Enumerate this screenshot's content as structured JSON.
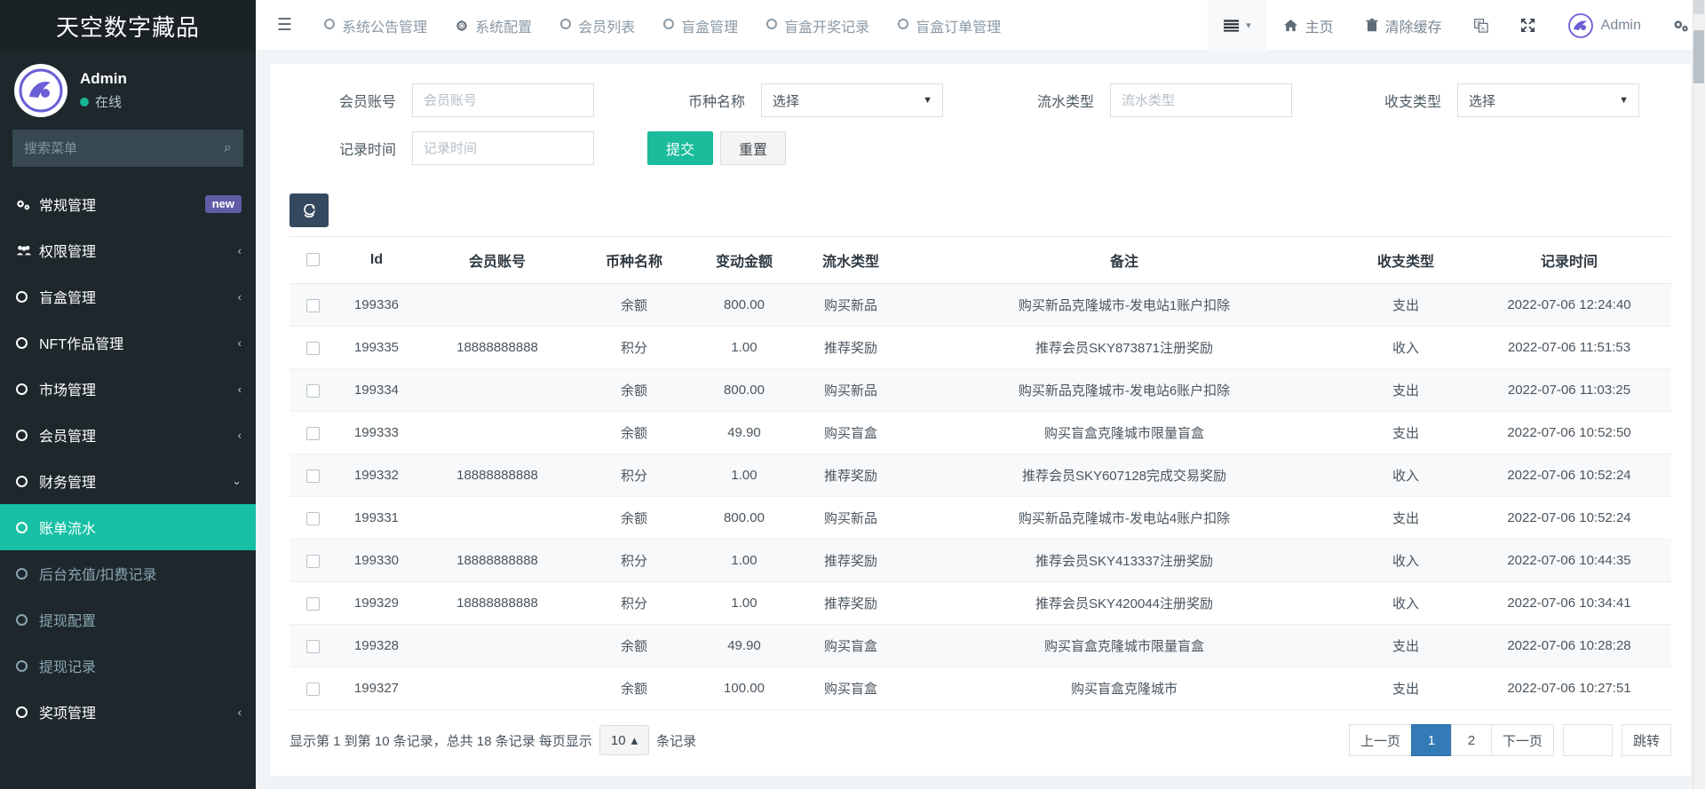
{
  "sidebar": {
    "brand": "天空数字藏品",
    "user": {
      "name": "Admin",
      "status": "在线"
    },
    "search_placeholder": "搜索菜单",
    "items": [
      {
        "label": "常规管理",
        "icon": "gears-icon",
        "badge": "new",
        "chevron": "",
        "kind": "top"
      },
      {
        "label": "权限管理",
        "icon": "users-icon",
        "badge": "",
        "chevron": "‹",
        "kind": "top"
      },
      {
        "label": "盲盒管理",
        "icon": "circle-icon",
        "badge": "",
        "chevron": "‹",
        "kind": "top"
      },
      {
        "label": "NFT作品管理",
        "icon": "circle-icon",
        "badge": "",
        "chevron": "‹",
        "kind": "top"
      },
      {
        "label": "市场管理",
        "icon": "circle-icon",
        "badge": "",
        "chevron": "‹",
        "kind": "top"
      },
      {
        "label": "会员管理",
        "icon": "circle-icon",
        "badge": "",
        "chevron": "‹",
        "kind": "top"
      },
      {
        "label": "财务管理",
        "icon": "circle-icon",
        "badge": "",
        "chevron": "⌄",
        "kind": "top-open"
      },
      {
        "label": "账单流水",
        "icon": "circle-icon",
        "badge": "",
        "chevron": "",
        "kind": "active"
      },
      {
        "label": "后台充值/扣费记录",
        "icon": "circle-icon",
        "badge": "",
        "chevron": "",
        "kind": "sub"
      },
      {
        "label": "提现配置",
        "icon": "circle-icon",
        "badge": "",
        "chevron": "",
        "kind": "sub"
      },
      {
        "label": "提现记录",
        "icon": "circle-icon",
        "badge": "",
        "chevron": "",
        "kind": "sub"
      },
      {
        "label": "奖项管理",
        "icon": "circle-icon",
        "badge": "",
        "chevron": "‹",
        "kind": "top"
      }
    ]
  },
  "topbar": {
    "hamburger": "☰",
    "tabs": [
      {
        "label": "系统公告管理",
        "icon": "circle-icon"
      },
      {
        "label": "系统配置",
        "icon": "gear-icon"
      },
      {
        "label": "会员列表",
        "icon": "circle-icon"
      },
      {
        "label": "盲盒管理",
        "icon": "circle-icon"
      },
      {
        "label": "盲盒开奖记录",
        "icon": "circle-icon"
      },
      {
        "label": "盲盒订单管理",
        "icon": "circle-icon"
      }
    ],
    "right": [
      {
        "label": "",
        "icon": "list-menu-icon",
        "caret": "▾",
        "boxed": true
      },
      {
        "label": "主页",
        "icon": "home-icon",
        "caret": "",
        "boxed": false
      },
      {
        "label": "清除缓存",
        "icon": "trash-icon",
        "caret": "",
        "boxed": false
      },
      {
        "label": "",
        "icon": "language-icon",
        "caret": "",
        "boxed": false
      },
      {
        "label": "",
        "icon": "fullscreen-icon",
        "caret": "",
        "boxed": false
      },
      {
        "label": "Admin",
        "icon": "avatar-icon",
        "caret": "",
        "boxed": false
      },
      {
        "label": "",
        "icon": "settings-gears-icon",
        "caret": "",
        "boxed": false
      }
    ]
  },
  "filters": {
    "account_label": "会员账号",
    "account_placeholder": "会员账号",
    "account_value": "",
    "currency_label": "币种名称",
    "currency_value": "选择",
    "flow_label": "流水类型",
    "flow_placeholder": "流水类型",
    "flow_value": "",
    "inout_label": "收支类型",
    "inout_value": "选择",
    "time_label": "记录时间",
    "time_placeholder": "记录时间",
    "time_value": "",
    "submit_label": "提交",
    "reset_label": "重置",
    "refresh_icon": "refresh-icon"
  },
  "table": {
    "columns": [
      "Id",
      "会员账号",
      "币种名称",
      "变动金额",
      "流水类型",
      "备注",
      "收支类型",
      "记录时间"
    ],
    "rows": [
      {
        "id": "199336",
        "account": "",
        "currency": "余额",
        "amount": "800.00",
        "flow": "购买新品",
        "remark": "购买新品克隆城市-发电站1账户扣除",
        "inout": "支出",
        "inout_type": "out",
        "time": "2022-07-06 12:24:40"
      },
      {
        "id": "199335",
        "account": "18888888888",
        "currency": "积分",
        "amount": "1.00",
        "flow": "推荐奖励",
        "remark": "推荐会员SKY873871注册奖励",
        "inout": "收入",
        "inout_type": "in",
        "time": "2022-07-06 11:51:53"
      },
      {
        "id": "199334",
        "account": "",
        "currency": "余额",
        "amount": "800.00",
        "flow": "购买新品",
        "remark": "购买新品克隆城市-发电站6账户扣除",
        "inout": "支出",
        "inout_type": "out",
        "time": "2022-07-06 11:03:25"
      },
      {
        "id": "199333",
        "account": "",
        "currency": "余额",
        "amount": "49.90",
        "flow": "购买盲盒",
        "remark": "购买盲盒克隆城市限量盲盒",
        "inout": "支出",
        "inout_type": "out",
        "time": "2022-07-06 10:52:50"
      },
      {
        "id": "199332",
        "account": "18888888888",
        "currency": "积分",
        "amount": "1.00",
        "flow": "推荐奖励",
        "remark": "推荐会员SKY607128完成交易奖励",
        "inout": "收入",
        "inout_type": "in",
        "time": "2022-07-06 10:52:24"
      },
      {
        "id": "199331",
        "account": "",
        "currency": "余额",
        "amount": "800.00",
        "flow": "购买新品",
        "remark": "购买新品克隆城市-发电站4账户扣除",
        "inout": "支出",
        "inout_type": "out",
        "time": "2022-07-06 10:52:24"
      },
      {
        "id": "199330",
        "account": "18888888888",
        "currency": "积分",
        "amount": "1.00",
        "flow": "推荐奖励",
        "remark": "推荐会员SKY413337注册奖励",
        "inout": "收入",
        "inout_type": "in",
        "time": "2022-07-06 10:44:35"
      },
      {
        "id": "199329",
        "account": "18888888888",
        "currency": "积分",
        "amount": "1.00",
        "flow": "推荐奖励",
        "remark": "推荐会员SKY420044注册奖励",
        "inout": "收入",
        "inout_type": "in",
        "time": "2022-07-06 10:34:41"
      },
      {
        "id": "199328",
        "account": "",
        "currency": "余额",
        "amount": "49.90",
        "flow": "购买盲盒",
        "remark": "购买盲盒克隆城市限量盲盒",
        "inout": "支出",
        "inout_type": "out",
        "time": "2022-07-06 10:28:28"
      },
      {
        "id": "199327",
        "account": "",
        "currency": "余额",
        "amount": "100.00",
        "flow": "购买盲盒",
        "remark": "购买盲盒克隆城市",
        "inout": "支出",
        "inout_type": "out",
        "time": "2022-07-06 10:27:51"
      }
    ]
  },
  "footer": {
    "summary_pre": "显示第 1 到第 10 条记录，总共 18 条记录 每页显示",
    "page_size": "10",
    "page_size_caret": "▴",
    "summary_post": "条记录",
    "prev_label": "上一页",
    "pages": [
      "1",
      "2"
    ],
    "active_page": "1",
    "next_label": "下一页",
    "jump_value": "",
    "jump_label": "跳转"
  },
  "colors": {
    "sidebar_bg": "#1e282c",
    "accent_green": "#1abc9c",
    "active_menu": "#17c0a4",
    "page_active": "#337ab7",
    "badge_new": "#605ca8"
  }
}
